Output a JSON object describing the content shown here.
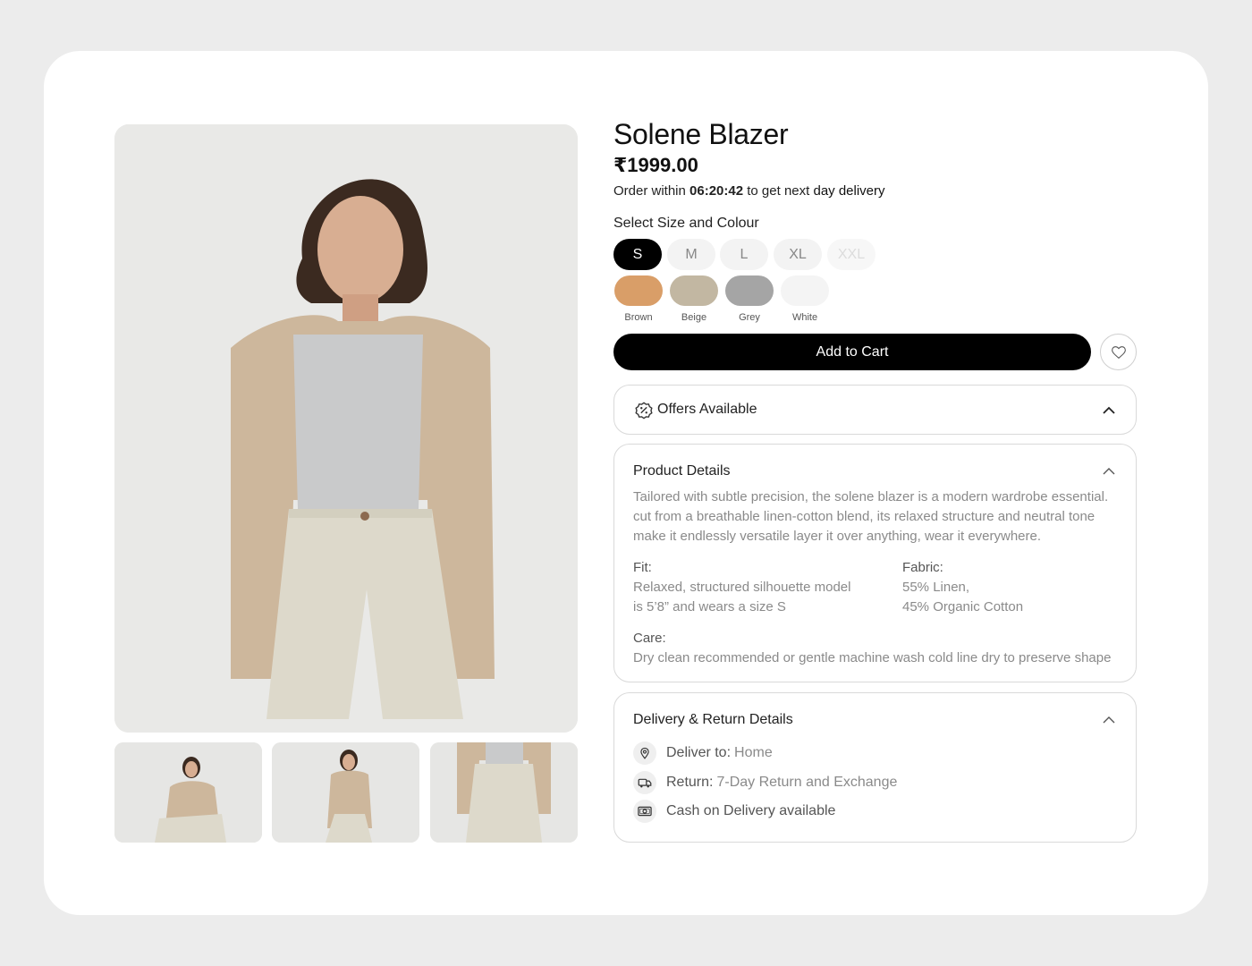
{
  "product": {
    "title": "Solene Blazer",
    "price": "₹1999.00"
  },
  "delivery_notice": {
    "prefix": "Order within",
    "countdown": "06:20:42",
    "middle": "to get next",
    "emphasis": "day delivery"
  },
  "selector": {
    "label": "Select Size and Colour",
    "sizes": [
      {
        "label": "S",
        "state": "selected"
      },
      {
        "label": "M",
        "state": "available"
      },
      {
        "label": "L",
        "state": "available"
      },
      {
        "label": "XL",
        "state": "available"
      },
      {
        "label": "XXL",
        "state": "disabled"
      }
    ],
    "colours": [
      {
        "label": "Brown",
        "hex": "#d99e68"
      },
      {
        "label": "Beige",
        "hex": "#c2b7a2"
      },
      {
        "label": "Grey",
        "hex": "#a5a5a5"
      },
      {
        "label": "White",
        "hex": "#f4f4f4"
      }
    ]
  },
  "actions": {
    "add_to_cart": "Add to Cart",
    "wishlist_icon": "heart-icon"
  },
  "offers": {
    "label": "Offers Available",
    "icon": "discount-badge-icon"
  },
  "details": {
    "title": "Product Details",
    "description": "Tailored with subtle precision, the solene blazer is a modern wardrobe essential. cut from a breathable linen-cotton blend, its relaxed structure and neutral tone make it endlessly versatile layer it over anything, wear it everywhere.",
    "fit_label": "Fit:",
    "fit_line1": "Relaxed, structured silhouette model",
    "fit_line2": "is 5’8” and wears a size S",
    "fabric_label": "Fabric:",
    "fabric_line1": "55% Linen,",
    "fabric_line2": "45% Organic Cotton",
    "care_label": "Care:",
    "care_value": "Dry clean recommended or gentle machine wash cold line dry to preserve shape"
  },
  "delivery_returns": {
    "title": "Delivery & Return Details",
    "deliver_key": "Deliver to:",
    "deliver_value": "Home",
    "return_key": "Return:",
    "return_value": "7-Day Return and Exchange",
    "cod": "Cash on Delivery available"
  },
  "colors": {
    "primary": "#000000",
    "muted_text": "#8a8a8a",
    "border": "#d9d9d9",
    "page_bg": "#ececec"
  }
}
